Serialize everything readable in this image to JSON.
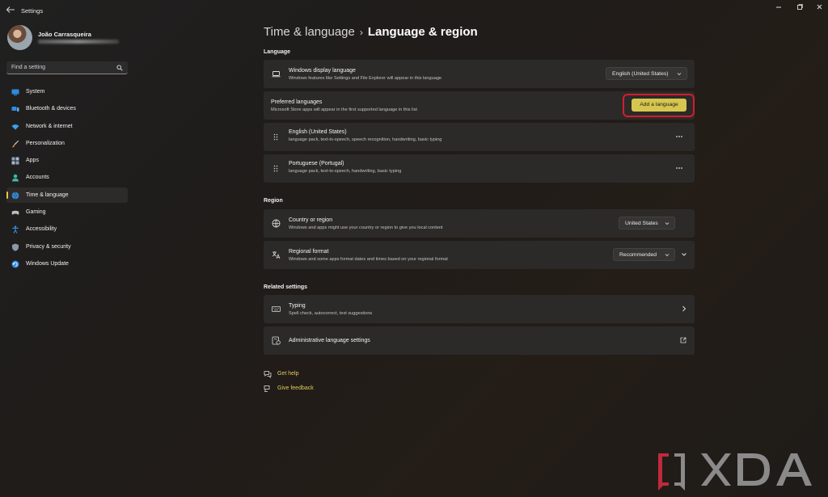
{
  "window": {
    "title": "Settings"
  },
  "user": {
    "name": "João Carrasqueira"
  },
  "search": {
    "placeholder": "Find a setting"
  },
  "nav": {
    "items": [
      {
        "label": "System",
        "icon": "monitor-icon",
        "color": "#2f8be0"
      },
      {
        "label": "Bluetooth & devices",
        "icon": "bluetooth-devices-icon",
        "color": "#2f8be0"
      },
      {
        "label": "Network & internet",
        "icon": "wifi-icon",
        "color": "#3aa0e8"
      },
      {
        "label": "Personalization",
        "icon": "brush-icon",
        "color": "#e0a030"
      },
      {
        "label": "Apps",
        "icon": "apps-icon",
        "color": "#8aa0b8"
      },
      {
        "label": "Accounts",
        "icon": "person-icon",
        "color": "#3cb6a4"
      },
      {
        "label": "Time & language",
        "icon": "globe-clock-icon",
        "color": "#3a8fe0"
      },
      {
        "label": "Gaming",
        "icon": "gamepad-icon",
        "color": "#b8c0c8"
      },
      {
        "label": "Accessibility",
        "icon": "accessibility-icon",
        "color": "#3a8fe0"
      },
      {
        "label": "Privacy & security",
        "icon": "shield-icon",
        "color": "#8a98a8"
      },
      {
        "label": "Windows Update",
        "icon": "update-icon",
        "color": "#2f8be0"
      }
    ],
    "active_index": 6
  },
  "breadcrumb": {
    "parent": "Time & language",
    "separator": "›",
    "current": "Language & region"
  },
  "language_section": {
    "title": "Language",
    "display_language": {
      "title": "Windows display language",
      "description": "Windows features like Settings and File Explorer will appear in this language",
      "value": "English (United States)"
    },
    "preferred": {
      "title": "Preferred languages",
      "description": "Microsoft Store apps will appear in the first supported language in this list",
      "add_button": "Add a language"
    },
    "languages": [
      {
        "name": "English (United States)",
        "features": "language pack, text-to-speech, speech recognition, handwriting, basic typing"
      },
      {
        "name": "Portuguese (Portugal)",
        "features": "language pack, text-to-speech, handwriting, basic typing"
      }
    ]
  },
  "region_section": {
    "title": "Region",
    "country": {
      "title": "Country or region",
      "description": "Windows and apps might use your country or region to give you local content",
      "value": "United States"
    },
    "format": {
      "title": "Regional format",
      "description": "Windows and some apps format dates and times based on your regional format",
      "value": "Recommended"
    }
  },
  "related_section": {
    "title": "Related settings",
    "typing": {
      "title": "Typing",
      "description": "Spell check, autocorrect, text suggestions"
    },
    "admin": {
      "title": "Administrative language settings"
    }
  },
  "footer": {
    "help": "Get help",
    "feedback": "Give feedback"
  },
  "colors": {
    "accent": "#d6c64f",
    "highlight": "#d61c2c",
    "link": "#e3c85a"
  },
  "watermark": {
    "text": "XDA"
  }
}
